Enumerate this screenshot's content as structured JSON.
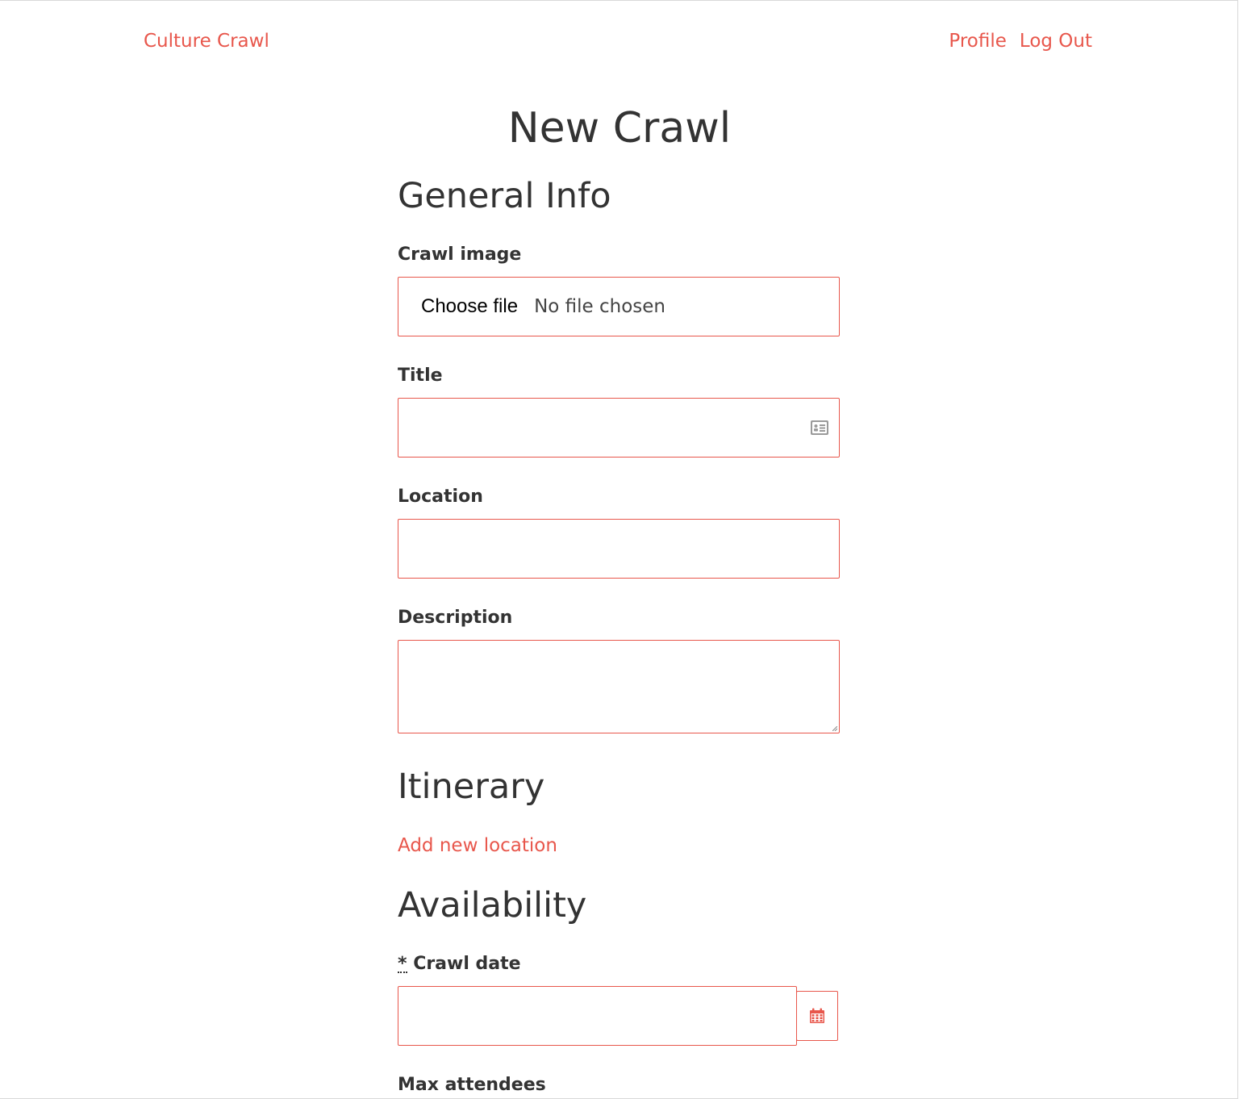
{
  "navbar": {
    "brand": "Culture Crawl",
    "links": [
      "Profile",
      "Log Out"
    ]
  },
  "page": {
    "title": "New Crawl"
  },
  "general_info": {
    "heading": "General Info",
    "crawl_image": {
      "label": "Crawl image",
      "button": "Choose file",
      "status": "No file chosen"
    },
    "title": {
      "label": "Title",
      "value": "",
      "icon": "contact-card-icon"
    },
    "location": {
      "label": "Location",
      "value": ""
    },
    "description": {
      "label": "Description",
      "value": ""
    }
  },
  "itinerary": {
    "heading": "Itinerary",
    "add_link": "Add new location"
  },
  "availability": {
    "heading": "Availability",
    "crawl_date": {
      "required_mark": "*",
      "label": "Crawl date",
      "value": "",
      "icon": "calendar-icon"
    },
    "max_attendees": {
      "label": "Max attendees"
    }
  },
  "colors": {
    "accent": "#e8574c",
    "text": "#333333"
  }
}
